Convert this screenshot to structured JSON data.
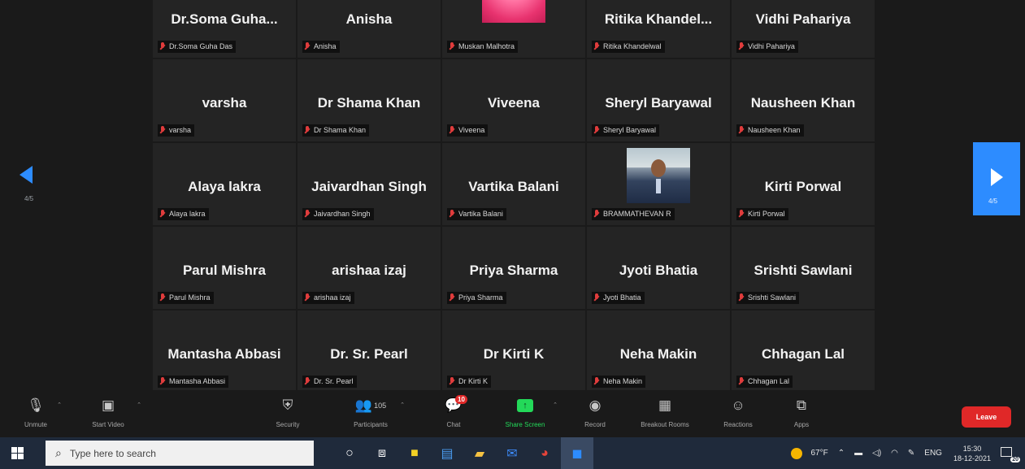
{
  "gallery": {
    "page_indicator_left": "4/5",
    "page_indicator_right": "4/5",
    "tiles": [
      {
        "display": "Dr.Soma  Guha...",
        "caption": "Dr.Soma Guha Das",
        "photo": ""
      },
      {
        "display": "Anisha",
        "caption": "Anisha",
        "photo": ""
      },
      {
        "display": "",
        "caption": "Muskan Malhotra",
        "photo": "flower"
      },
      {
        "display": "Ritika  Khandel...",
        "caption": "Ritika Khandelwal",
        "photo": ""
      },
      {
        "display": "Vidhi Pahariya",
        "caption": "Vidhi Pahariya",
        "photo": ""
      },
      {
        "display": "varsha",
        "caption": "varsha",
        "photo": ""
      },
      {
        "display": "Dr Shama Khan",
        "caption": "Dr Shama Khan",
        "photo": ""
      },
      {
        "display": "Viveena",
        "caption": "Viveena",
        "photo": ""
      },
      {
        "display": "Sheryl Baryawal",
        "caption": "Sheryl Baryawal",
        "photo": ""
      },
      {
        "display": "Nausheen Khan",
        "caption": "Nausheen Khan",
        "photo": ""
      },
      {
        "display": "Alaya lakra",
        "caption": "Alaya lakra",
        "photo": ""
      },
      {
        "display": "Jaivardhan Singh",
        "caption": "Jaivardhan Singh",
        "photo": ""
      },
      {
        "display": "Vartika Balani",
        "caption": "Vartika Balani",
        "photo": ""
      },
      {
        "display": "",
        "caption": "BRAMMATHEVAN R",
        "photo": "man"
      },
      {
        "display": "Kirti Porwal",
        "caption": "Kirti Porwal",
        "photo": ""
      },
      {
        "display": "Parul Mishra",
        "caption": "Parul Mishra",
        "photo": ""
      },
      {
        "display": "arishaa izaj",
        "caption": "arishaa izaj",
        "photo": ""
      },
      {
        "display": "Priya Sharma",
        "caption": "Priya Sharma",
        "photo": ""
      },
      {
        "display": "Jyoti Bhatia",
        "caption": "Jyoti Bhatia",
        "photo": ""
      },
      {
        "display": "Srishti Sawlani",
        "caption": "Srishti Sawlani",
        "photo": ""
      },
      {
        "display": "Mantasha Abbasi",
        "caption": "Mantasha Abbasi",
        "photo": ""
      },
      {
        "display": "Dr. Sr. Pearl",
        "caption": "Dr. Sr. Pearl",
        "photo": ""
      },
      {
        "display": "Dr Kirti K",
        "caption": "Dr Kirti K",
        "photo": ""
      },
      {
        "display": "Neha Makin",
        "caption": "Neha Makin",
        "photo": ""
      },
      {
        "display": "Chhagan Lal",
        "caption": "Chhagan Lal",
        "photo": ""
      }
    ]
  },
  "toolbar": {
    "unmute": "Unmute",
    "start_video": "Start Video",
    "security": "Security",
    "participants": "Participants",
    "participants_count": "105",
    "chat": "Chat",
    "chat_badge": "10",
    "share_screen": "Share Screen",
    "record": "Record",
    "breakout_rooms": "Breakout Rooms",
    "reactions": "Reactions",
    "apps": "Apps",
    "leave": "Leave"
  },
  "taskbar": {
    "search_placeholder": "Type here to search",
    "temperature": "67°F",
    "language": "ENG",
    "time": "15:30",
    "date": "18-12-2021",
    "notification_count": "20"
  },
  "colors": {
    "accent": "#2d8cff",
    "leave": "#e02828",
    "share_green": "#23d959",
    "muted_red": "#e03c3c"
  }
}
